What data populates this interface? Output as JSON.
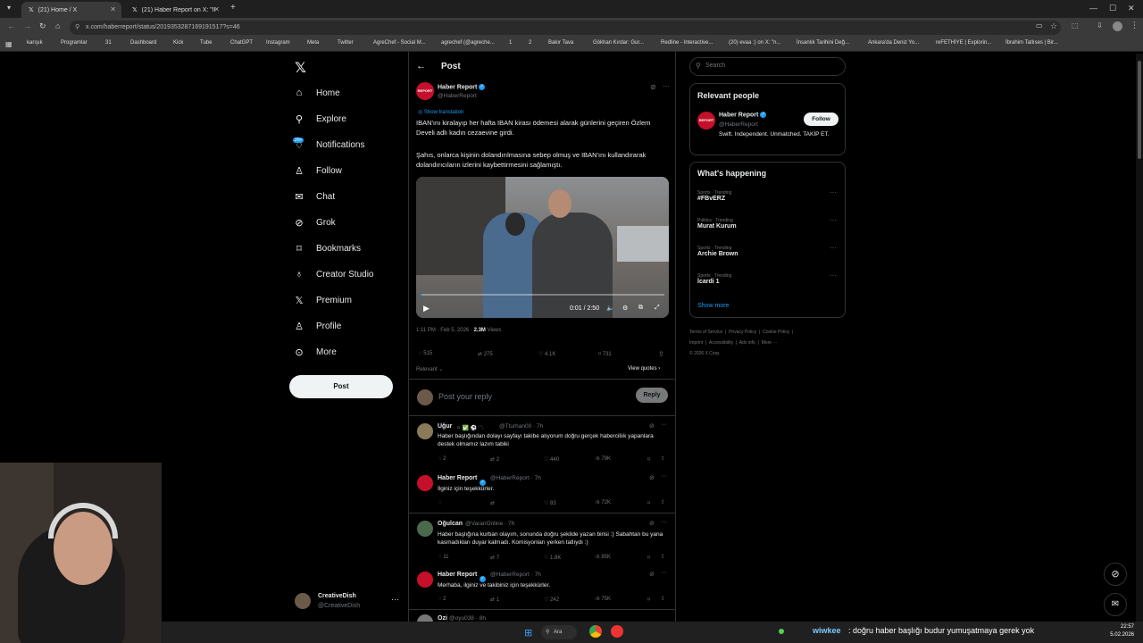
{
  "browser": {
    "tabs": [
      {
        "title": "(21) Home / X"
      },
      {
        "title": "(21) Haber Report on X: \"IBAN'..."
      }
    ],
    "url": "x.com/haberreport/status/2019353287169191517?s=46",
    "bookmarks": [
      "karışık",
      "Programlar",
      "31",
      "Dashboard",
      "Kick",
      "Tube",
      "ChatGPT",
      "Instagram",
      "Meta",
      "Twitter",
      "AgreChef - Social M...",
      "agrechef (@agreche...",
      "1",
      "2",
      "Bakır Tava",
      "Gökhan Kırdar: Gur...",
      "Redline - Interactive...",
      "(20) evaa :) on X: \"n...",
      "İnsanlık Tarihini Değ...",
      "Ankara'da Deniz Yo...",
      "reFETHİYE | Explorin...",
      "İbrahim Tatlıses | Bir..."
    ]
  },
  "sidebar": {
    "nav": [
      {
        "label": "Home",
        "icon": "home-icon"
      },
      {
        "label": "Explore",
        "icon": "search-icon"
      },
      {
        "label": "Notifications",
        "icon": "bell-icon",
        "badge": "20+"
      },
      {
        "label": "Follow",
        "icon": "person-add-icon"
      },
      {
        "label": "Chat",
        "icon": "mail-icon"
      },
      {
        "label": "Grok",
        "icon": "grok-icon"
      },
      {
        "label": "Bookmarks",
        "icon": "bookmark-icon"
      },
      {
        "label": "Creator Studio",
        "icon": "creator-icon"
      },
      {
        "label": "Premium",
        "icon": "x-icon"
      },
      {
        "label": "Profile",
        "icon": "profile-icon"
      },
      {
        "label": "More",
        "icon": "more-icon"
      }
    ],
    "post_button": "Post",
    "user": {
      "name": "CreativeDish",
      "handle": "@CreativeDish"
    }
  },
  "post": {
    "header": "Post",
    "author": {
      "name": "Haber Report",
      "handle": "@HaberReport"
    },
    "show_translation": "Show translation",
    "text1": "IBAN'ını kiralayıp her hafta IBAN kirası ödemesi alarak günlerini geçiren Özlem Develi adlı kadın cezaevine girdi.",
    "text2": "Şahıs, onlarca kişinin dolandırılmasına sebep olmuş ve IBAN'ını kullandırarak dolandırıcıların izlerini kaybettirmesini sağlamıştı.",
    "video_time": "0:01 / 2:50",
    "video_progress": 0.006,
    "meta_time": "1:11 PM · Feb 5, 2026 ·",
    "views_count": "2.3M",
    "views_label": "Views",
    "stats": {
      "replies": "515",
      "reposts": "275",
      "likes": "4.1K",
      "bookmarks": "731"
    },
    "sort": "Relevant",
    "view_quotes": "View quotes",
    "reply_placeholder": "Post your reply",
    "reply_button": "Reply"
  },
  "replies": [
    {
      "name": "Uğur",
      "handle": "@Tturhan00 · 7h",
      "text": "Haber başlığından dolayı sayfayı takibe alıyorum doğru gerçek haberciliık yapanlara destek olmamız lazım tabiki",
      "stats": [
        "2",
        "2",
        "440",
        "79K"
      ]
    },
    {
      "name": "Haber Report",
      "handle": "@HaberReport · 7h",
      "text": "İlginiz için teşekkürler.",
      "stats": [
        "",
        "",
        "83",
        "72K"
      ]
    },
    {
      "name": "Oğulcan",
      "handle": "@VaranOnline · 7h",
      "text": "Haber başlığına kurban olayım, sonunda doğru şekilde yazan birisi :) Sabahtan bu yana kasmadıkları duyar kalmadı. Komisyonları yerken tatlıydı :)",
      "stats": [
        "11",
        "7",
        "1.8K",
        "85K"
      ]
    },
    {
      "name": "Haber Report",
      "handle": "@HaberReport · 7h",
      "text": "Merhaba, ilginiz ve takibiniz için teşekkürler.",
      "stats": [
        "2",
        "1",
        "242",
        "75K"
      ]
    },
    {
      "name": "Ozi",
      "handle": "@oyu038 · 8h",
      "text": "",
      "stats": []
    }
  ],
  "right": {
    "search_placeholder": "Search",
    "relevant_title": "Relevant people",
    "person": {
      "name": "Haber Report",
      "handle": "@HaberReport",
      "bio": "Swift. Independent. Unmatched. TAKİP ET.",
      "follow": "Follow"
    },
    "happening_title": "What's happening",
    "trends": [
      {
        "cat": "Sports · Trending",
        "name": "#FBvERZ"
      },
      {
        "cat": "Politics · Trending",
        "name": "Murat Kurum"
      },
      {
        "cat": "Sports · Trending",
        "name": "Archie Brown"
      },
      {
        "cat": "Sports · Trending",
        "name": "İcardi 1"
      }
    ],
    "show_more": "Show more",
    "footer": [
      "Terms of Service",
      "Privacy Policy",
      "Cookie Policy",
      "Imprint",
      "Accessibility",
      "Ads info",
      "More ···",
      "© 2026 X Corp."
    ]
  },
  "overlay": {
    "chat_text": "doğru haber başlığı budur yumuşatmaya gerek yok",
    "chat_user": "wiwkee",
    "taskbar_search": "Ara",
    "clock_time": "22:57",
    "clock_date": "5.02.2026"
  },
  "colors": {
    "accent": "#1d9bf0",
    "bg": "#000000",
    "border": "#2f3336",
    "muted": "#71767b",
    "brand_red": "#c4102b"
  }
}
